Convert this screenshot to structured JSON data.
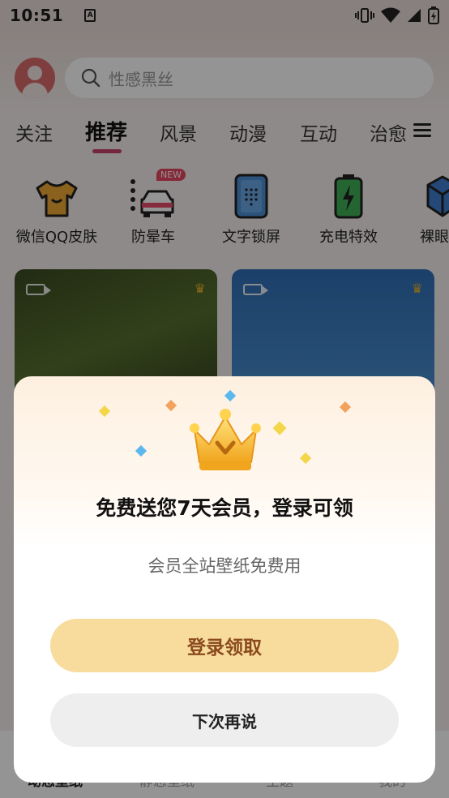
{
  "status_bar": {
    "time": "10:51",
    "accessibility_badge": "A"
  },
  "search": {
    "placeholder": "性感黑丝"
  },
  "tabs": [
    {
      "label": "关注"
    },
    {
      "label": "推荐",
      "active": true
    },
    {
      "label": "风景"
    },
    {
      "label": "动漫"
    },
    {
      "label": "互动"
    },
    {
      "label": "治愈"
    }
  ],
  "categories": [
    {
      "label": "微信QQ皮肤",
      "icon": "tshirt-icon"
    },
    {
      "label": "防晕车",
      "icon": "car-icon",
      "badge": "NEW"
    },
    {
      "label": "文字锁屏",
      "icon": "phone-icon"
    },
    {
      "label": "充电特效",
      "icon": "battery-icon"
    },
    {
      "label": "裸眼",
      "icon": "cube-icon"
    }
  ],
  "bottom_nav": [
    "动态壁纸",
    "静态壁纸",
    "主题",
    "我的"
  ],
  "modal": {
    "title": "免费送您7天会员，登录可领",
    "subtitle": "会员全站壁纸免费用",
    "primary_label": "登录领取",
    "secondary_label": "下次再说"
  },
  "colors": {
    "accent": "#c8436b",
    "primary_button_bg": "#f8dc9d",
    "primary_button_text": "#8a4a1e",
    "secondary_button_bg": "#eeeeee"
  }
}
